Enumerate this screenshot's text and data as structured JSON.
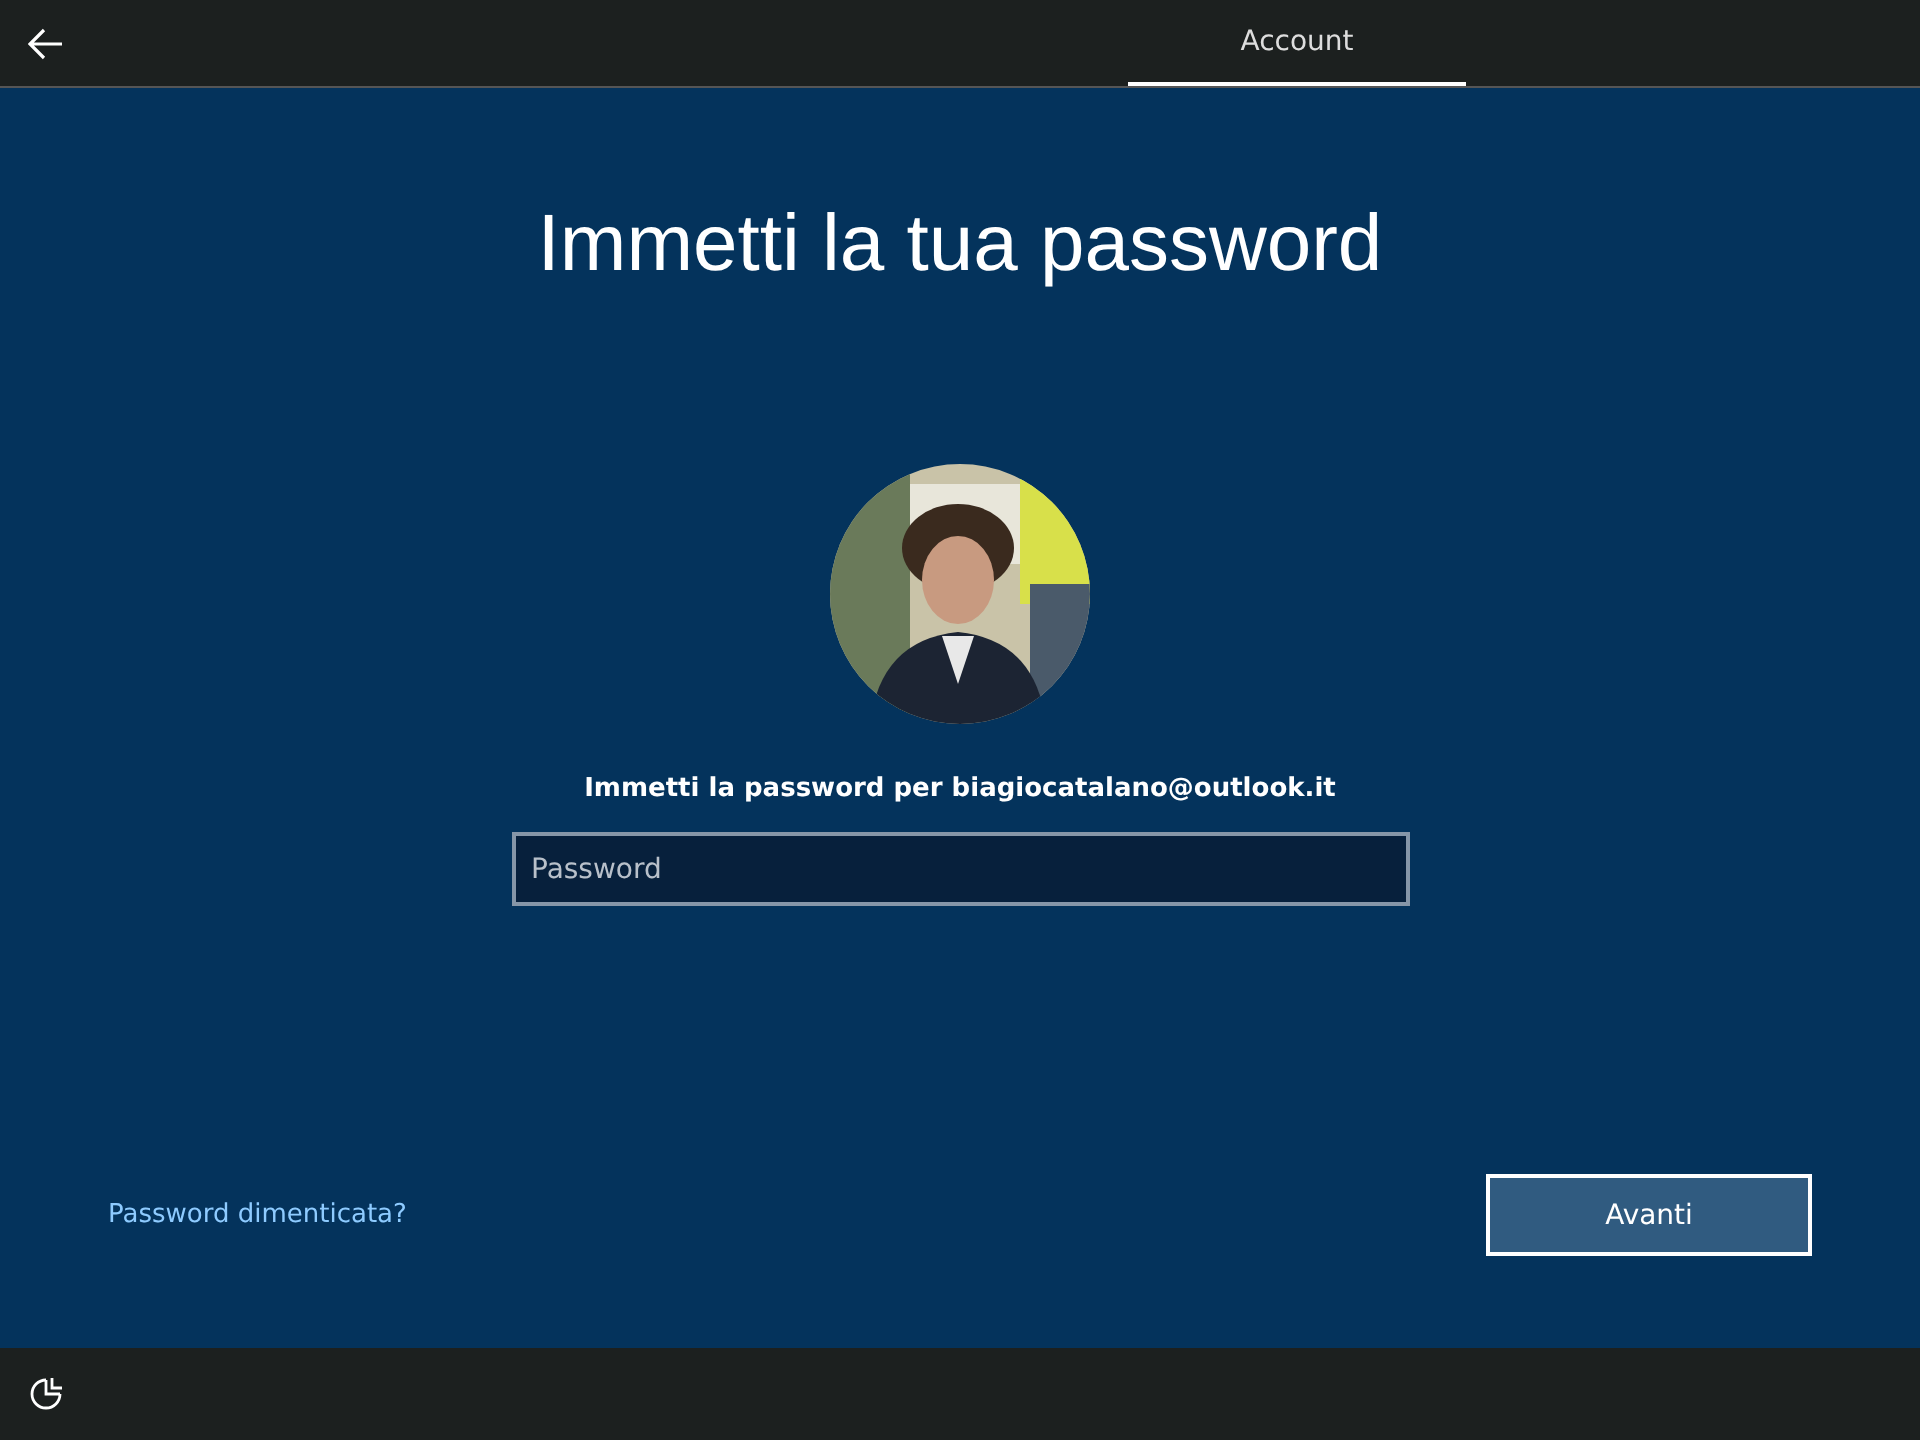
{
  "top_bar": {
    "tabs": [
      {
        "label": "Account",
        "selected": true
      }
    ]
  },
  "title": "Immetti la tua password",
  "prompt": "Immetti la password per biagiocatalano@outlook.it",
  "password_field": {
    "placeholder": "Password"
  },
  "forgot_link": "Password dimenticata?",
  "buttons": [
    "Avanti"
  ]
}
